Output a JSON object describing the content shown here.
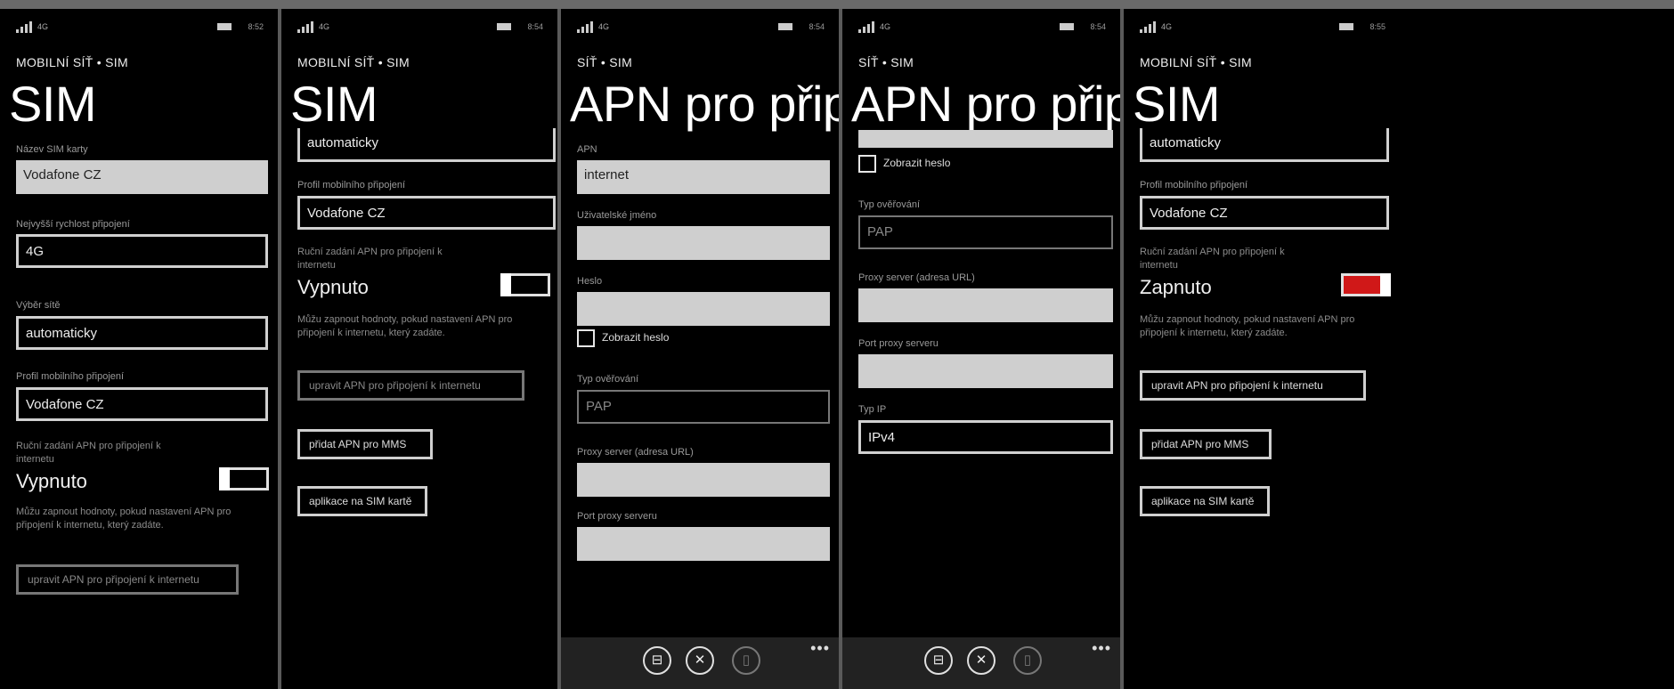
{
  "status": {
    "network": "4G",
    "clock1": "8:52",
    "clock2": "8:54",
    "clock3": "8:54",
    "clock4": "8:54",
    "clock5": "8:55"
  },
  "p1": {
    "crumb": "MOBILNÍ SÍŤ • SIM",
    "title": "SIM",
    "sim_name_label": "Název SIM karty",
    "sim_name_value": "Vodafone CZ",
    "speed_label": "Nejvyšší rychlost připojení",
    "speed_value": "4G",
    "network_label": "Výběr sítě",
    "network_value": "automaticky",
    "profile_label": "Profil mobilního připojení",
    "profile_value": "Vodafone CZ",
    "apn_manual_label": "Ruční zadání APN pro připojení k internetu",
    "toggle_state": "Vypnuto",
    "apn_desc": "Můžu zapnout hodnoty, pokud nastavení APN pro připojení k internetu, který zadáte.",
    "edit_apn_button": "upravit APN pro připojení k internetu"
  },
  "p2": {
    "crumb": "MOBILNÍ SÍŤ • SIM",
    "title": "SIM",
    "network_value": "automaticky",
    "profile_label": "Profil mobilního připojení",
    "profile_value": "Vodafone CZ",
    "apn_manual_label": "Ruční zadání APN pro připojení k internetu",
    "toggle_state": "Vypnuto",
    "apn_desc": "Můžu zapnout hodnoty, pokud nastavení APN pro připojení k internetu, který zadáte.",
    "edit_apn_button": "upravit APN pro připojení k internetu",
    "add_mms_button": "přidat APN pro MMS",
    "sim_apps_button": "aplikace na SIM kartě"
  },
  "p3": {
    "crumb": "SÍŤ • SIM",
    "title": "APN pro připojení",
    "apn_label": "APN",
    "apn_value": "internet",
    "user_label": "Uživatelské jméno",
    "password_label": "Heslo",
    "show_password": "Zobrazit heslo",
    "auth_label": "Typ ověřování",
    "auth_value": "PAP",
    "proxy_label": "Proxy server (adresa URL)",
    "proxy_port_label": "Port proxy serveru"
  },
  "p4": {
    "crumb": "SÍŤ • SIM",
    "title": "APN pro připojení",
    "show_password": "Zobrazit heslo",
    "auth_label": "Typ ověřování",
    "auth_value": "PAP",
    "proxy_label": "Proxy server (adresa URL)",
    "proxy_port_label": "Port proxy serveru",
    "ip_label": "Typ IP",
    "ip_value": "IPv4"
  },
  "p5": {
    "crumb": "MOBILNÍ SÍŤ • SIM",
    "title": "SIM",
    "network_value": "automaticky",
    "profile_label": "Profil mobilního připojení",
    "profile_value": "Vodafone CZ",
    "apn_manual_label": "Ruční zadání APN pro připojení k internetu",
    "toggle_state": "Zapnuto",
    "apn_desc": "Můžu zapnout hodnoty, pokud nastavení APN pro připojení k internetu, který zadáte.",
    "edit_apn_button": "upravit APN pro připojení k internetu",
    "add_mms_button": "přidat APN pro MMS",
    "sim_apps_button": "aplikace na SIM kartě"
  },
  "appbar": {
    "save_glyph": "⊟",
    "cancel_glyph": "✕",
    "delete_glyph": "🗑",
    "more": "•••"
  },
  "colors": {
    "accent": "#d01818",
    "field_fill": "#cfcfcf",
    "appbar": "#222222"
  },
  "icons": [
    "signal-icon",
    "battery-icon",
    "save-icon",
    "cancel-icon",
    "delete-icon",
    "more-icon"
  ]
}
